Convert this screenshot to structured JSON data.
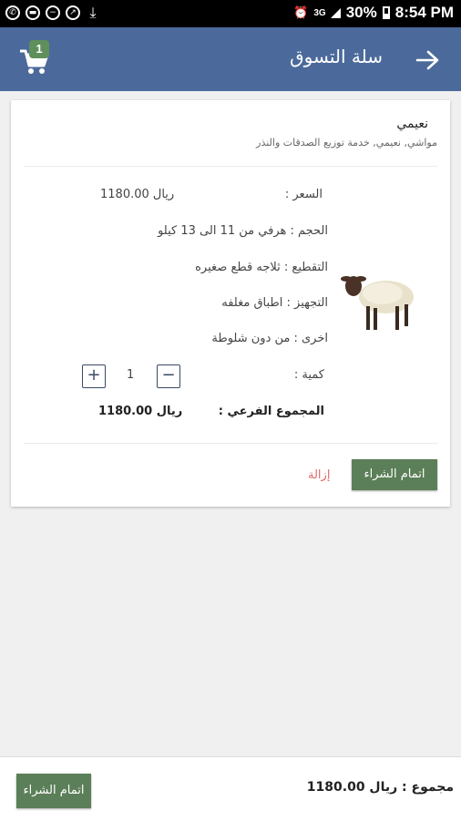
{
  "status_bar": {
    "battery": "30%",
    "time": "8:54 PM",
    "signal": "3G"
  },
  "app_bar": {
    "title": "سلة التسوق",
    "cart_badge": "1"
  },
  "cart_item": {
    "title": "نعيمي",
    "subtitle": "مواشي, نعيمي, خدمة توزيع الصدقات والنذر",
    "price_label": "السعر :",
    "price_value": "ريال 1180.00",
    "size_line": "الحجم : هرفي من 11 الى 13 كيلو",
    "cutting_line": "التقطيع : ثلاجه قطع صغيره",
    "packing_line": "التجهيز : اطباق مغلفه",
    "other_line": "اخرى : من دون شلوطة",
    "quantity_label": "كمية :",
    "quantity_value": "1",
    "plus_symbol": "+",
    "minus_symbol": "−",
    "subtotal_label": "المجموع الفرعي :",
    "subtotal_value": "ريال 1180.00",
    "checkout_label": "اتمام الشراء",
    "remove_label": "إزالة"
  },
  "bottom_bar": {
    "total_text": "مجموع : ريال 1180.00",
    "checkout_label": "اتمام الشراء"
  },
  "colors": {
    "app_bar": "#4b6a9b",
    "button_green": "#5b7f58",
    "remove_red": "#e06a6a"
  }
}
